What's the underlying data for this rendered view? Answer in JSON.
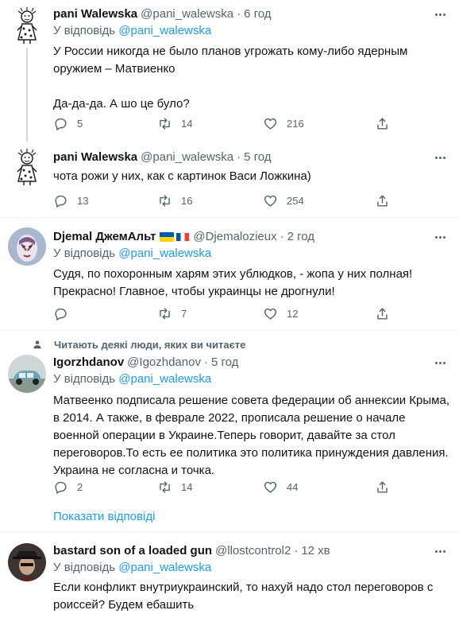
{
  "tweets": [
    {
      "name": "pani Walewska",
      "handle": "@pani_walewska",
      "time": "6 год",
      "reply_prefix": "У відповідь",
      "reply_to": "@pani_walewska",
      "text": "У России никогда не было планов угрожать кому-либо ядерным оружием – Матвиенко\n\nДа-да-да. А шо це було?",
      "replies": "5",
      "retweets": "14",
      "likes": "216"
    },
    {
      "name": "pani Walewska",
      "handle": "@pani_walewska",
      "time": "5 год",
      "text": "чота рожи у них, как с картинок Васи Ложкина)",
      "replies": "13",
      "retweets": "16",
      "likes": "254"
    },
    {
      "name": "Djemal ДжемАльт",
      "handle": "@Djemalozieux",
      "time": "2 год",
      "reply_prefix": "У відповідь",
      "reply_to": "@pani_walewska",
      "text": "Судя, по похоронным харям этих ублюдков, - жопа у них полная! Прекрасно! Главное, чтобы украинцы не дрогнули!",
      "replies": "",
      "retweets": "7",
      "likes": "12"
    },
    {
      "social_context": "Читають деякі люди, яких ви читаєте",
      "name": "Igorzhdanov",
      "handle": "@Igozhdanov",
      "time": "5 год",
      "reply_prefix": "У відповідь",
      "reply_to": "@pani_walewska",
      "text": "Матвеенко подписала решение совета федерации об аннексии Крыма, в 2014. А также, в феврале 2022, прописала решение о начале военной операции в Украине.Теперь говорит, давайте за стол переговоров.То есть ее политика это политика принуждения давления.\nУкраина не согласна и точка.",
      "replies": "2",
      "retweets": "14",
      "likes": "44"
    },
    {
      "name": "bastard son of a loaded gun",
      "handle": "@llostcontrol2",
      "time": "12 хв",
      "reply_prefix": "У відповідь",
      "reply_to": "@pani_walewska",
      "text": "Если конфликт внутриукраинский, то нахуй надо стол переговоров с роиссей? Будем ебашить"
    }
  ],
  "show_replies": "Показати відповіді",
  "separator": "·"
}
